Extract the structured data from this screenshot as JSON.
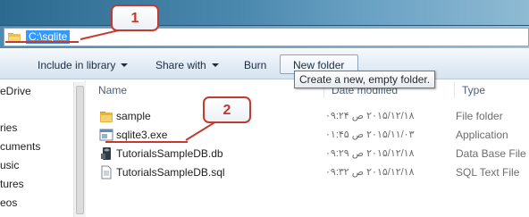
{
  "address_bar": {
    "path": "C:\\sqlite"
  },
  "toolbar": {
    "include_in_library": "Include in library",
    "share_with": "Share with",
    "burn": "Burn",
    "new_folder": "New folder"
  },
  "tooltip": "Create a new, empty folder.",
  "nav_pane": {
    "items": [
      "eDrive",
      "ries",
      "cuments",
      "usic",
      "tures",
      "eos"
    ]
  },
  "columns": {
    "name": "Name",
    "date_modified": "Date modified",
    "type": "Type"
  },
  "files": [
    {
      "name": "sample",
      "date": "۲۰۱۵/۱۲/۱۸ ص ۰۹:۲۴",
      "type": "File folder",
      "icon": "folder-icon"
    },
    {
      "name": "sqlite3.exe",
      "date": "۲۰۱۵/۱۱/۰۳ ص ۰۱:۴۵",
      "type": "Application",
      "icon": "application-icon"
    },
    {
      "name": "TutorialsSampleDB.db",
      "date": "۲۰۱۵/۱۲/۱۸ ص ۰۹:۲۹",
      "type": "Data Base File",
      "icon": "database-file-icon"
    },
    {
      "name": "TutorialsSampleDB.sql",
      "date": "۲۰۱۵/۱۲/۱۸ ص ۰۹:۳۲",
      "type": "SQL Text File",
      "icon": "text-file-icon"
    }
  ],
  "annotations": {
    "callout_1": "1",
    "callout_2": "2"
  },
  "colors": {
    "annotation_red": "#c53a2f",
    "selection_blue": "#3399ff"
  }
}
